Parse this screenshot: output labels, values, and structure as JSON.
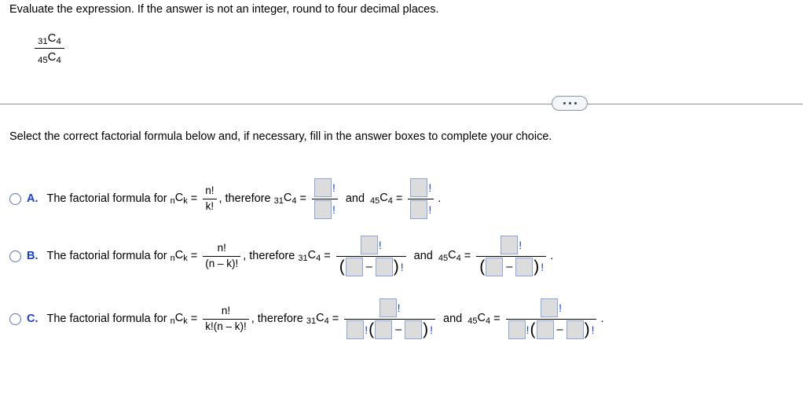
{
  "problem": {
    "instruction": "Evaluate the expression. If the answer is not an integer, round to four decimal places.",
    "expression": {
      "numerator": {
        "pre": "31",
        "base": "C",
        "post": "4"
      },
      "denominator": {
        "pre": "45",
        "base": "C",
        "post": "4"
      }
    }
  },
  "divider": {
    "ellipsis_label": "•••",
    "dot": "",
    "line_color": "#8b94a3"
  },
  "select_prompt": "Select the correct factorial formula below and, if necessary, fill in the answer boxes to complete your choice.",
  "symbols": {
    "bang": "!",
    "minus": "–",
    "eq": "=",
    "comma": ",",
    "period": ".",
    "and": "and",
    "lparen": "(",
    "rparen": ")",
    "therefore": "therefore",
    "lead_text": "The factorial formula for",
    "nck_pre": "n",
    "nck_base": "C",
    "nck_post": "k",
    "c31_pre": "31",
    "c31_base": "C",
    "c31_post": "4",
    "c45_pre": "45",
    "c45_base": "C",
    "c45_post": "4",
    "num_nfact": "n!"
  },
  "choices": [
    {
      "id": "A",
      "letter": "A.",
      "selected": false,
      "formula": {
        "numerator": "n!",
        "denominator": "k!"
      },
      "answer_pattern": "simple"
    },
    {
      "id": "B",
      "letter": "B.",
      "selected": false,
      "formula": {
        "numerator": "n!",
        "denominator": "(n – k)!"
      },
      "answer_pattern": "paren"
    },
    {
      "id": "C",
      "letter": "C.",
      "selected": false,
      "formula": {
        "numerator": "n!",
        "denominator": "k!(n – k)!"
      },
      "answer_pattern": "kfact-paren"
    }
  ],
  "colors": {
    "accent_blue": "#1a3fd4",
    "radio_blue": "#5b6fc4",
    "box_fill": "#dcdcdc",
    "box_border": "#8aa6dd",
    "divider": "#8b94a3"
  }
}
